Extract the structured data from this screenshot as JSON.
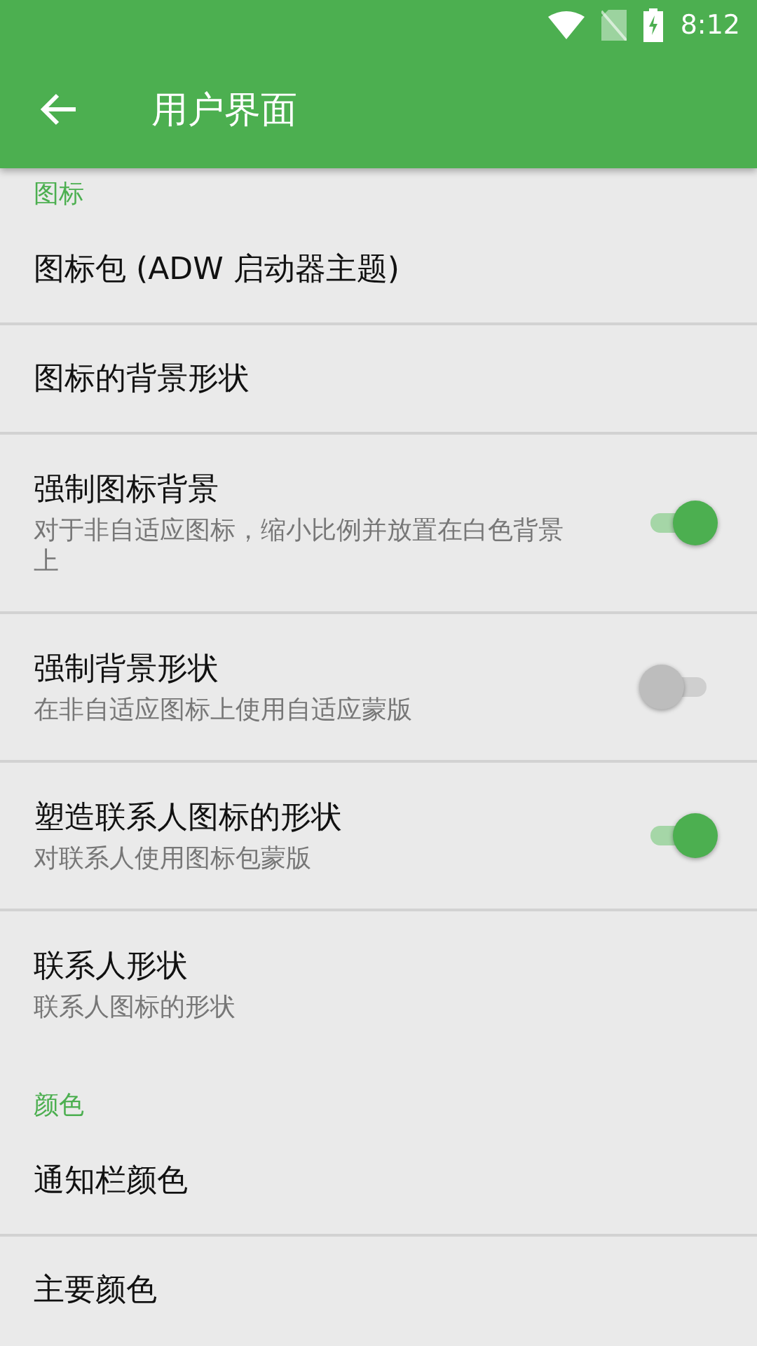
{
  "status_bar": {
    "time": "8:12"
  },
  "toolbar": {
    "title": "用户界面"
  },
  "sections": [
    {
      "title": "图标",
      "items": [
        {
          "kind": "plain",
          "title": "图标包 (ADW 启动器主题)",
          "divider": true
        },
        {
          "kind": "plain",
          "title": "图标的背景形状",
          "divider": true
        },
        {
          "kind": "switch",
          "title": "强制图标背景",
          "summary": "对于非自适应图标，缩小比例并放置在白色背景上",
          "on": true,
          "divider": true
        },
        {
          "kind": "switch",
          "title": "强制背景形状",
          "summary": "在非自适应图标上使用自适应蒙版",
          "on": false,
          "divider": true
        },
        {
          "kind": "switch",
          "title": "塑造联系人图标的形状",
          "summary": "对联系人使用图标包蒙版",
          "on": true,
          "divider": true
        },
        {
          "kind": "plain",
          "title": "联系人形状",
          "summary": "联系人图标的形状",
          "divider": false
        }
      ]
    },
    {
      "title": "颜色",
      "items": [
        {
          "kind": "plain",
          "title": "通知栏颜色",
          "divider": true
        },
        {
          "kind": "plain",
          "title": "主要颜色"
        }
      ]
    }
  ]
}
